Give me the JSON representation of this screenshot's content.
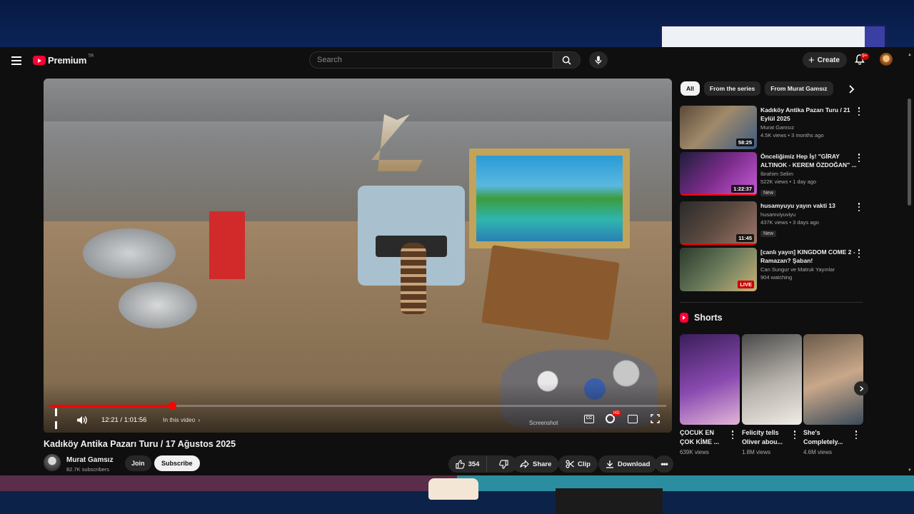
{
  "header": {
    "logo_text": "Premium",
    "logo_sup": "TR",
    "search_placeholder": "Search",
    "create_label": "Create",
    "notification_badge": "9+"
  },
  "player": {
    "current_time": "12:21",
    "duration": "1:01:56",
    "time_display": "12:21 / 1:01:56",
    "chapter_label": "In this video",
    "progress_fraction": 0.199,
    "hd_badge": "HD",
    "cc_label": "CC",
    "overlay_label": "Screenshot"
  },
  "video": {
    "title": "Kadıköy Antika Pazarı Turu / 17 Ağustos 2025",
    "channel_name": "Murat Gamsız",
    "channel_subs": "82.7K subscribers",
    "join_label": "Join",
    "subscribe_label": "Subscribe",
    "like_count": "354",
    "share_label": "Share",
    "clip_label": "Clip",
    "download_label": "Download"
  },
  "sidebar": {
    "chips": [
      {
        "label": "All",
        "active": true
      },
      {
        "label": "From the series",
        "active": false
      },
      {
        "label": "From Murat Gamsız",
        "active": false
      }
    ],
    "recommendations": [
      {
        "title": "Kadıköy Antika Pazarı Turu / 21 Eylül 2025",
        "channel": "Murat Gamsız",
        "meta": "4.5K views • 3 months ago",
        "duration": "58:25",
        "badge": "",
        "live": false,
        "watched_fraction": 0
      },
      {
        "title": "Önceliğimiz Hep İş! \"GİRAY ALTINOK - KEREM ÖZDOĞAN\" ...",
        "channel": "İbrahim Selim",
        "meta": "522K views • 1 day ago",
        "duration": "1:22:37",
        "badge": "New",
        "live": false,
        "watched_fraction": 1.0
      },
      {
        "title": "husamyuyu yayın vakti 13",
        "channel": "husamviyuviyu",
        "meta": "437K views • 3 days ago",
        "duration": "11:45",
        "badge": "New",
        "live": false,
        "watched_fraction": 1.0
      },
      {
        "title": "[canlı yayın] KINGDOM COME 2 - Ramazan? Şaban!",
        "channel": "Can Sungur ve Matruk Yayınlar",
        "meta": "904 watching",
        "duration": "LIVE",
        "badge": "",
        "live": true,
        "watched_fraction": 0
      }
    ],
    "shorts_header": "Shorts",
    "shorts": [
      {
        "title": "ÇOCUK EN ÇOK KİME ...",
        "views": "639K views"
      },
      {
        "title": "Felicity tells Oliver abou...",
        "views": "1.8M views"
      },
      {
        "title": "She's Completely...",
        "views": "4.6M views"
      }
    ]
  },
  "colors": {
    "accent": "#ff0000",
    "background": "#0f0f0f",
    "chip_bg": "#272727"
  }
}
